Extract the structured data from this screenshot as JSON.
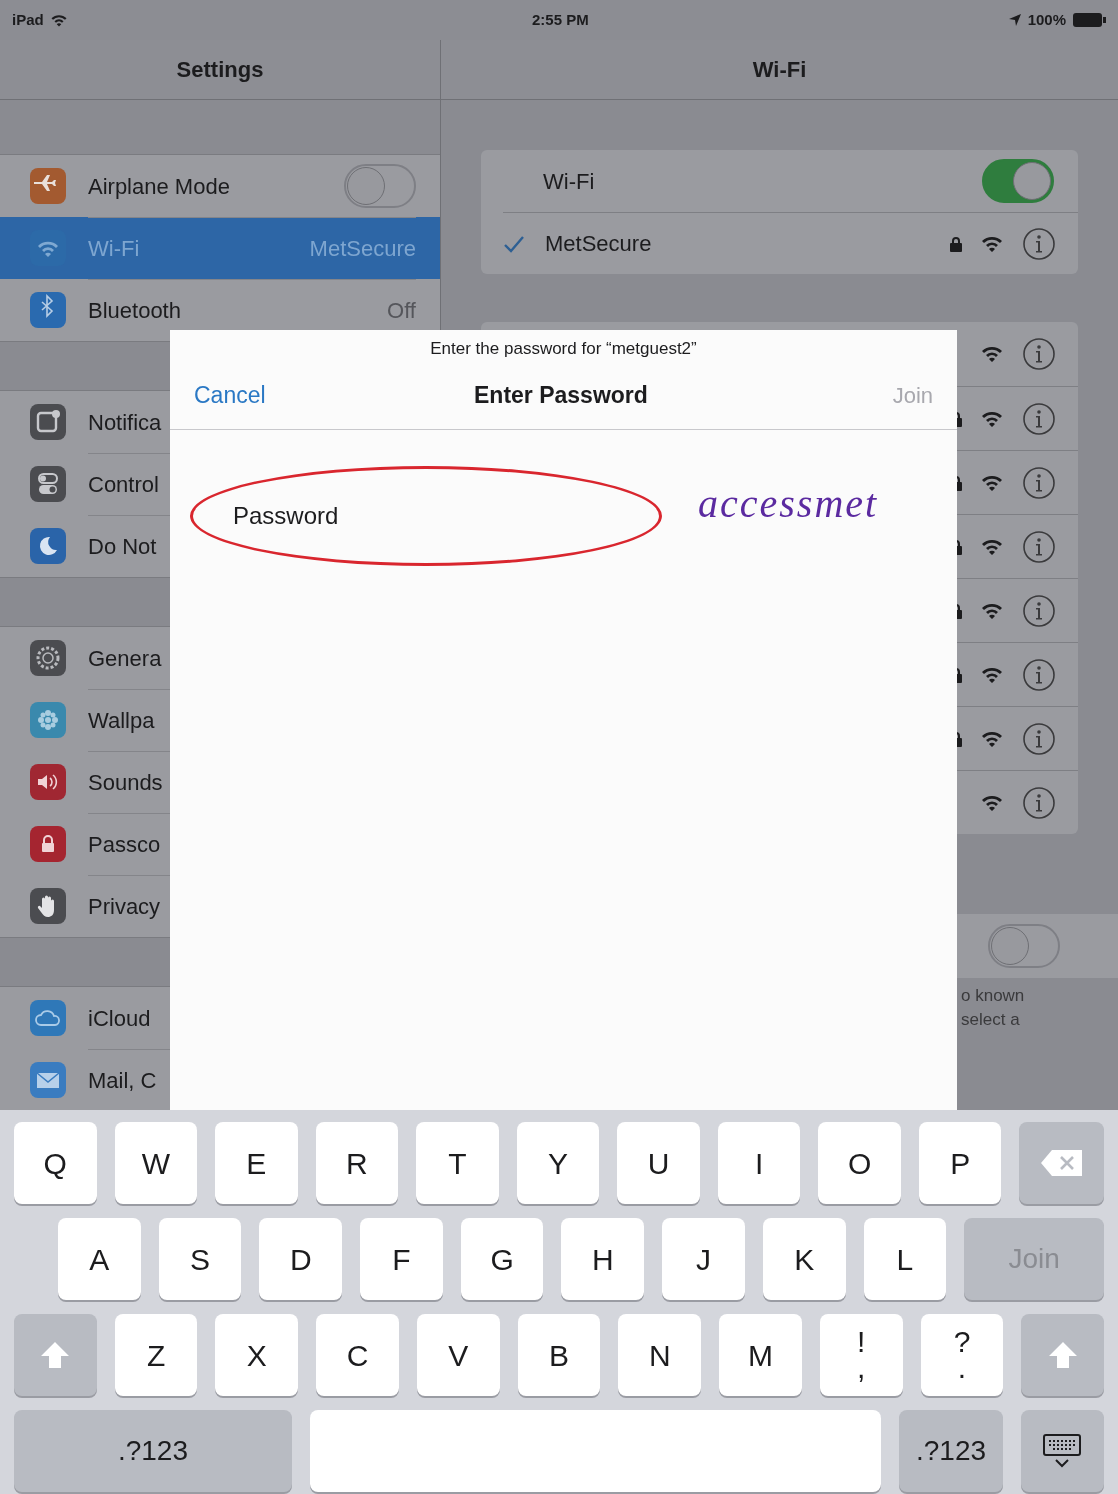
{
  "status_bar": {
    "device": "iPad",
    "time": "2:55 PM",
    "battery": "100%"
  },
  "sidebar": {
    "title": "Settings",
    "groups": [
      [
        {
          "label": "Airplane Mode",
          "toggle": false,
          "selected": false
        },
        {
          "label": "Wi-Fi",
          "value": "MetSecure",
          "selected": true
        },
        {
          "label": "Bluetooth",
          "value": "Off",
          "selected": false
        }
      ],
      [
        {
          "label": "Notifica",
          "selected": false
        },
        {
          "label": "Control",
          "selected": false
        },
        {
          "label": "Do Not",
          "selected": false
        }
      ],
      [
        {
          "label": "Genera",
          "selected": false
        },
        {
          "label": "Wallpa",
          "selected": false
        },
        {
          "label": "Sounds",
          "selected": false
        },
        {
          "label": "Passco",
          "selected": false
        },
        {
          "label": "Privacy",
          "selected": false
        }
      ],
      [
        {
          "label": "iCloud",
          "selected": false
        },
        {
          "label": "Mail, C",
          "selected": false
        }
      ]
    ]
  },
  "detail": {
    "title": "Wi-Fi",
    "wifi_toggle": {
      "label": "Wi-Fi",
      "on": true
    },
    "current": {
      "name": "MetSecure",
      "checked": true,
      "locked": true
    },
    "networks": [
      {
        "locked": false
      },
      {
        "locked": true
      },
      {
        "locked": true
      },
      {
        "locked": true
      },
      {
        "locked": true
      },
      {
        "locked": true
      },
      {
        "locked": true
      },
      {
        "locked": false
      }
    ],
    "ask_toggle": {
      "on": false
    },
    "footer": [
      "o known",
      "select a"
    ]
  },
  "dialog": {
    "subtitle": "Enter the password for “metguest2”",
    "cancel": "Cancel",
    "title": "Enter Password",
    "join": {
      "label": "Join",
      "disabled": true
    },
    "field": {
      "placeholder": "Password"
    },
    "annotation": "accessmet"
  },
  "keyboard": {
    "key_rows": [
      {
        "keys": [
          {
            "kind": "letter",
            "label": "Q"
          },
          {
            "kind": "letter",
            "label": "W"
          },
          {
            "kind": "letter",
            "label": "E"
          },
          {
            "kind": "letter",
            "label": "R"
          },
          {
            "kind": "letter",
            "label": "T"
          },
          {
            "kind": "letter",
            "label": "Y"
          },
          {
            "kind": "letter",
            "label": "U"
          },
          {
            "kind": "letter",
            "label": "I"
          },
          {
            "kind": "letter",
            "label": "O"
          },
          {
            "kind": "letter",
            "label": "P"
          },
          {
            "kind": "delete"
          }
        ]
      },
      {
        "keys": [
          {
            "kind": "letter",
            "label": "A"
          },
          {
            "kind": "letter",
            "label": "S"
          },
          {
            "kind": "letter",
            "label": "D"
          },
          {
            "kind": "letter",
            "label": "F"
          },
          {
            "kind": "letter",
            "label": "G"
          },
          {
            "kind": "letter",
            "label": "H"
          },
          {
            "kind": "letter",
            "label": "J"
          },
          {
            "kind": "letter",
            "label": "K"
          },
          {
            "kind": "letter",
            "label": "L"
          },
          {
            "kind": "return",
            "label": "Join",
            "disabled": true
          }
        ]
      },
      {
        "keys": [
          {
            "kind": "shift"
          },
          {
            "kind": "letter",
            "label": "Z"
          },
          {
            "kind": "letter",
            "label": "X"
          },
          {
            "kind": "letter",
            "label": "C"
          },
          {
            "kind": "letter",
            "label": "V"
          },
          {
            "kind": "letter",
            "label": "B"
          },
          {
            "kind": "letter",
            "label": "N"
          },
          {
            "kind": "letter",
            "label": "M"
          },
          {
            "kind": "pair",
            "label": "!",
            "sub": ","
          },
          {
            "kind": "pair",
            "label": "?",
            "sub": "."
          },
          {
            "kind": "shift"
          }
        ]
      },
      {
        "keys": [
          {
            "kind": "mode",
            "label": ".?123"
          },
          {
            "kind": "space"
          },
          {
            "kind": "mode",
            "label": ".?123"
          },
          {
            "kind": "hide"
          }
        ]
      }
    ]
  }
}
